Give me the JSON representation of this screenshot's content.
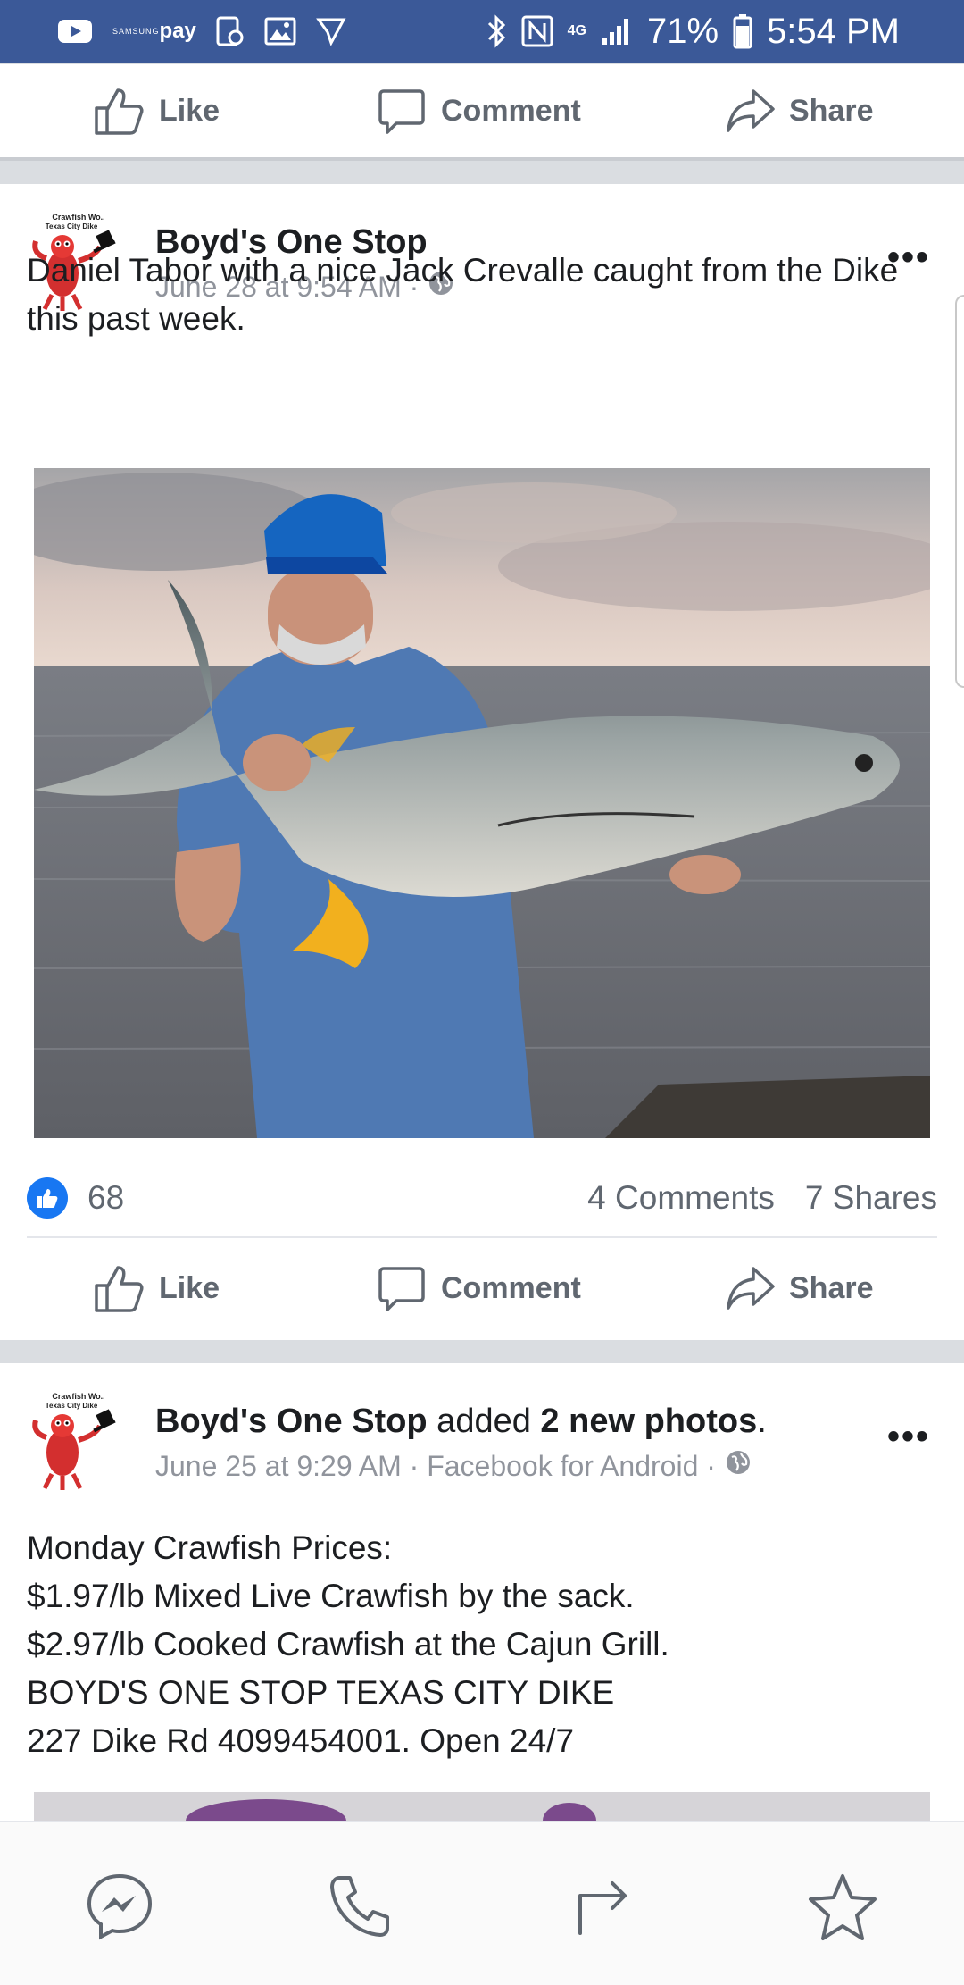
{
  "status_bar": {
    "pay_label": "pay",
    "samsung_label": "SAMSUNG",
    "battery": "71%",
    "time": "5:54 PM",
    "signal_label": "4G"
  },
  "top_actions": {
    "like": "Like",
    "comment": "Comment",
    "share": "Share"
  },
  "post1": {
    "avatar_caption": "Crawfish Wo.. Texas City Dike",
    "author": "Boyd's One Stop",
    "timestamp": "June 28 at 9:54 AM ·",
    "more": "•••",
    "text": "Daniel Tabor with a nice Jack Crevalle caught from the Dike this past week.",
    "likes": "68",
    "comments": "4 Comments",
    "shares": "7 Shares",
    "actions": {
      "like": "Like",
      "comment": "Comment",
      "share": "Share"
    }
  },
  "post2": {
    "avatar_caption": "Crawfish Wo.. Texas City Dike",
    "author": "Boyd's One Stop",
    "verb": " added ",
    "object": "2 new photos",
    "period": ".",
    "timestamp": "June 25 at 9:29 AM · Facebook for Android ·",
    "more": "•••",
    "lines": [
      "Monday Crawfish Prices:",
      "$1.97/lb Mixed Live Crawfish by the sack.",
      "$2.97/lb Cooked Crawfish at the Cajun Grill.",
      "BOYD'S ONE STOP TEXAS CITY DIKE",
      "227 Dike Rd 4099454001. Open 24/7"
    ]
  },
  "bottom_nav": [
    "messenger-icon",
    "phone-icon",
    "forward-icon",
    "star-icon"
  ],
  "colors": {
    "status_bar": "#3b5998",
    "like_blue": "#1877f2",
    "muted": "#606770",
    "meta": "#90949c"
  }
}
